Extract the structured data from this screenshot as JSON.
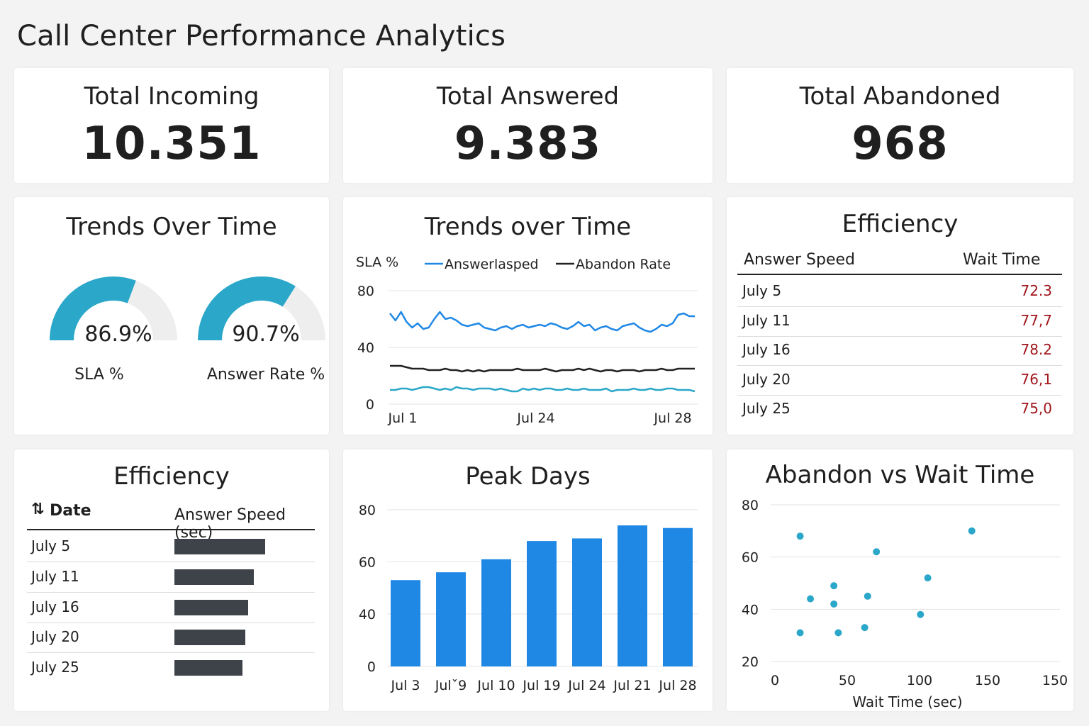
{
  "page": {
    "title": "Call Center Performance Analytics"
  },
  "kpis": [
    {
      "title": "Total Incoming",
      "value": "10.351"
    },
    {
      "title": "Total Answered",
      "value": "9.383"
    },
    {
      "title": "Total Abandoned",
      "value": "968"
    }
  ],
  "gauges": {
    "title": "Trends Over Time",
    "items": [
      {
        "value": 86.9,
        "display": "86.9%",
        "label": "SLA %"
      },
      {
        "value": 90.7,
        "display": "90.7%",
        "label": "Answer Rate %"
      }
    ]
  },
  "efficiency_table": {
    "title": "Efficiency",
    "headers": [
      "Answer Speed",
      "Wait Time"
    ],
    "rows": [
      {
        "date": "July 5",
        "value": "72.3"
      },
      {
        "date": "July 11",
        "value": "77,7"
      },
      {
        "date": "July 16",
        "value": "78.2"
      },
      {
        "date": "July 20",
        "value": "76,1"
      },
      {
        "date": "July 25",
        "value": "75,0"
      }
    ]
  },
  "efficiency_bars": {
    "title": "Efficiency",
    "sort_icon": "sort-arrows-icon",
    "headers": [
      "Date",
      "Answer Speed (sec)"
    ],
    "rows": [
      {
        "date": "July 5",
        "value": 32
      },
      {
        "date": "July 11",
        "value": 28
      },
      {
        "date": "July 16",
        "value": 26
      },
      {
        "date": "July 20",
        "value": 25
      },
      {
        "date": "July 25",
        "value": 24
      }
    ]
  },
  "colors": {
    "blue": "#1f88e5",
    "black": "#222222",
    "teal": "#2aa7c9",
    "gauge_track": "#eeeeee",
    "bar_dark": "#3e4349",
    "red_text": "#a0161c"
  },
  "chart_data": [
    {
      "type": "line",
      "title": "Trends over Time",
      "ylabel": "SLA %",
      "ylim": [
        0,
        80
      ],
      "yticks": [
        0,
        40,
        80
      ],
      "xtick_labels": [
        "Jul 1",
        "Jul 24",
        "Jul 28"
      ],
      "legend_position": "top",
      "grid": true,
      "series": [
        {
          "name": "Answerlasped",
          "color": "#1f88e5",
          "values": [
            64,
            59,
            65,
            58,
            54,
            57,
            53,
            54,
            60,
            65,
            60,
            61,
            59,
            56,
            55,
            56,
            57,
            54,
            53,
            52,
            54,
            55,
            53,
            55,
            56,
            54,
            55,
            56,
            55,
            57,
            56,
            54,
            53,
            55,
            58,
            55,
            56,
            52,
            54,
            55,
            53,
            52,
            55,
            56,
            57,
            54,
            52,
            51,
            53,
            56,
            55,
            57,
            63,
            64,
            62,
            62
          ]
        },
        {
          "name": "Abandon Rate",
          "color": "#222222",
          "values": [
            27,
            27,
            27,
            26,
            25,
            25,
            25,
            24,
            24,
            24,
            25,
            24,
            24,
            23,
            24,
            23,
            24,
            23,
            24,
            24,
            24,
            24,
            24,
            25,
            24,
            24,
            24,
            24,
            25,
            24,
            23,
            24,
            24,
            24,
            25,
            24,
            25,
            24,
            23,
            24,
            24,
            23,
            24,
            24,
            24,
            23,
            24,
            24,
            24,
            25,
            24,
            24,
            25,
            25,
            25,
            25
          ]
        },
        {
          "color": "#2aa7c9",
          "values": [
            10,
            10,
            11,
            11,
            10,
            11,
            12,
            12,
            11,
            10,
            11,
            10,
            12,
            11,
            11,
            10,
            11,
            11,
            11,
            10,
            11,
            10,
            9,
            9,
            11,
            10,
            11,
            10,
            11,
            11,
            10,
            10,
            11,
            10,
            10,
            11,
            10,
            10,
            10,
            11,
            9,
            10,
            10,
            10,
            11,
            10,
            10,
            11,
            10,
            10,
            11,
            11,
            10,
            10,
            10,
            9
          ]
        }
      ]
    },
    {
      "type": "bar",
      "title": "Peak Days",
      "categories": [
        "Jul 3",
        "Julˇ9",
        "Jul 10",
        "Jul 19",
        "Jul 24",
        "Jul 21",
        "Jul 28"
      ],
      "values": [
        53,
        56,
        61,
        68,
        69,
        74,
        73
      ],
      "ylim": [
        0,
        80
      ],
      "yticks": [
        0,
        40,
        60,
        80
      ],
      "grid": true,
      "color": "#1f88e5"
    },
    {
      "type": "scatter",
      "title": "Abandon vs Wait Time",
      "xlabel": "Wait Time (sec)",
      "xlim": [
        0,
        150
      ],
      "ylim": [
        20,
        80
      ],
      "yticks": [
        20,
        40,
        60,
        80
      ],
      "xticks": [
        0,
        50,
        100,
        150
      ],
      "xtick_labels": [
        "0",
        "50",
        "100",
        "150",
        "150"
      ],
      "grid": true,
      "color": "#2aa7c9",
      "points": [
        {
          "x": 8,
          "y": 68
        },
        {
          "x": 8,
          "y": 31
        },
        {
          "x": 15,
          "y": 44
        },
        {
          "x": 31,
          "y": 49
        },
        {
          "x": 31,
          "y": 42
        },
        {
          "x": 34,
          "y": 31
        },
        {
          "x": 52,
          "y": 33
        },
        {
          "x": 54,
          "y": 45
        },
        {
          "x": 60,
          "y": 62
        },
        {
          "x": 90,
          "y": 38
        },
        {
          "x": 95,
          "y": 52
        },
        {
          "x": 125,
          "y": 70
        }
      ]
    }
  ]
}
